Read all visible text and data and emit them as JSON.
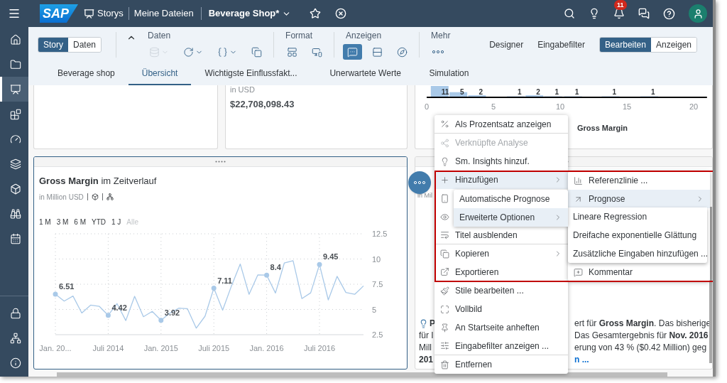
{
  "sidebar": {
    "items": [
      {
        "selected": false
      },
      {
        "selected": false
      },
      {
        "selected": true
      },
      {
        "selected": false
      },
      {
        "selected": false
      },
      {
        "selected": false
      },
      {
        "selected": false
      },
      {
        "selected": false
      },
      {
        "selected": false
      }
    ],
    "bottom_items": [
      {
        "selected": false
      },
      {
        "selected": false
      },
      {
        "selected": false
      }
    ]
  },
  "shell": {
    "logo": "SAP",
    "breadcrumbs": [
      "Storys",
      "Meine Dateien"
    ],
    "title": "Beverage Shop*",
    "notifications": "11"
  },
  "toolbar": {
    "modes": [
      {
        "label": "Story",
        "selected": true
      },
      {
        "label": "Daten",
        "selected": false
      }
    ],
    "groups": [
      {
        "label": "Daten",
        "tools": [
          {
            "selected": false,
            "disabled": true,
            "dropdown": true
          },
          {
            "selected": false,
            "disabled": false,
            "dropdown": true
          },
          {
            "selected": false,
            "disabled": false,
            "dropdown": true
          },
          {
            "selected": false,
            "disabled": false,
            "dropdown": false
          }
        ]
      },
      {
        "label": "Format",
        "tools": [
          {
            "selected": false,
            "disabled": false,
            "dropdown": false
          },
          {
            "selected": false,
            "disabled": false,
            "dropdown": false
          }
        ]
      },
      {
        "label": "Anzeigen",
        "tools": [
          {
            "selected": true,
            "disabled": false,
            "dropdown": false
          },
          {
            "selected": false,
            "disabled": false,
            "dropdown": false
          },
          {
            "selected": false,
            "disabled": false,
            "dropdown": false
          }
        ]
      },
      {
        "label": "Mehr",
        "tools": [
          {
            "selected": false,
            "disabled": false,
            "dropdown": false
          }
        ]
      }
    ],
    "links": [
      "Designer",
      "Eingabefilter"
    ],
    "view_modes": [
      {
        "label": "Bearbeiten",
        "selected": true
      },
      {
        "label": "Anzeigen",
        "selected": false
      }
    ]
  },
  "tabs": [
    {
      "label": "Beverage shop",
      "selected": false
    },
    {
      "label": "Übersicht",
      "selected": true
    },
    {
      "label": "Wichtigste Einflussfakt...",
      "selected": false
    },
    {
      "label": "Unerwartete Werte",
      "selected": false
    },
    {
      "label": "Simulation",
      "selected": false
    }
  ],
  "kpi_card": {
    "unit": "in USD",
    "value": "$22,708,098.43"
  },
  "histogram_card": {
    "chart_data": {
      "type": "bar",
      "xlabel": "Gross Margin",
      "x": [
        1,
        2.4,
        3.8,
        6.7,
        8.1,
        9.5,
        11,
        13.8,
        16.7
      ],
      "values": [
        11,
        5,
        2,
        1,
        2,
        1,
        1,
        1,
        1
      ],
      "xlim": [
        0,
        21
      ],
      "xticks": [
        0,
        5,
        10,
        15,
        20
      ],
      "data_labels": true
    }
  },
  "trend_card": {
    "title": "**Gross Margin** im Zeitverlauf",
    "subtitle": "in Million USD",
    "selected": true,
    "periods": [
      {
        "label": "1 M",
        "disabled": false
      },
      {
        "label": "3 M",
        "disabled": false
      },
      {
        "label": "6 M",
        "disabled": false
      },
      {
        "label": "YTD",
        "disabled": false
      },
      {
        "label": "1 J",
        "disabled": false
      },
      {
        "label": "Alle",
        "disabled": true
      }
    ],
    "chart_data": {
      "type": "line",
      "categories": [
        "Jan. 20...",
        null,
        null,
        null,
        null,
        null,
        "Juli 2014",
        null,
        null,
        null,
        null,
        null,
        "Jan. 2015",
        null,
        null,
        null,
        null,
        null,
        "Juli 2015",
        null,
        null,
        null,
        null,
        null,
        "Jan. 2016",
        null,
        null,
        null,
        null,
        null,
        "Juli 2016",
        null,
        null,
        null,
        null,
        null
      ],
      "series": [
        {
          "color": "#a9c9e8",
          "values": [
            6.51,
            5.83,
            6.33,
            4.65,
            5.43,
            5.3,
            4.42,
            5.58,
            3.9,
            6.3,
            4.28,
            4.8,
            3.92,
            4.63,
            5.13,
            5.08,
            3.15,
            4.33,
            7.11,
            4.93,
            7.33,
            9.5,
            6.5,
            8.43,
            8.4,
            6.63,
            9.6,
            9.83,
            6.08,
            6.65,
            9.45,
            5.95,
            8.28,
            6.68,
            6.5,
            7.33
          ]
        }
      ],
      "ylim": [
        2.5,
        12.5
      ],
      "grid": true,
      "yticks": [
        2.5,
        5,
        7.5,
        10,
        12.5
      ],
      "annotations": [
        {
          "x": "Jan. 20...",
          "y": 6.51,
          "text": "6.51"
        },
        {
          "x": "Juli 2014",
          "y": 4.42,
          "text": "4.42"
        },
        {
          "x": "Jan. 2015",
          "y": 3.92,
          "text": "3.92"
        },
        {
          "x": "Juli 2015",
          "y": 7.11,
          "text": "7.11"
        },
        {
          "x": "Jan. 2016",
          "y": 8.4,
          "text": "8.4"
        },
        {
          "x": "Juli 2016",
          "y": 9.45,
          "text": "9.45"
        }
      ]
    }
  },
  "insight_card": {
    "unit": "in Mil",
    "lines": [
      {
        "left": "**P**",
        "right": "ert für **Gross Margin**. Das bisherige"
      },
      {
        "left": "für I",
        "right": "Das Gesamtergebnis für **Nov. 2016**"
      },
      {
        "left": "Mill",
        "right": "erung von 43 % ($0.42 Million) geg"
      },
      {
        "left": "**201**",
        "right": "**n ...**"
      }
    ]
  },
  "context_menu": {
    "items": [
      {
        "kind": "item",
        "label": "Als Prozentsatz anzeigen",
        "disabled": false,
        "highlighted": false,
        "submenu": false,
        "divider_after": true
      },
      {
        "kind": "item",
        "label": "Verknüpfte Analyse",
        "disabled": true,
        "highlighted": false,
        "submenu": false,
        "divider_after": false
      },
      {
        "kind": "item",
        "label": "Sm. Insights hinzuf.",
        "disabled": false,
        "highlighted": false,
        "submenu": false,
        "divider_after": false
      },
      {
        "kind": "item",
        "label": "Hinzufügen",
        "disabled": false,
        "highlighted": true,
        "submenu": true,
        "divider_after": false
      },
      {
        "kind": "covered"
      },
      {
        "kind": "covered"
      },
      {
        "kind": "item",
        "label": "Titel ausblenden",
        "disabled": false,
        "highlighted": false,
        "submenu": false,
        "divider_after": true
      },
      {
        "kind": "item",
        "label": "Kopieren",
        "disabled": false,
        "highlighted": false,
        "submenu": true,
        "divider_after": false
      },
      {
        "kind": "item",
        "label": "Exportieren",
        "disabled": false,
        "highlighted": false,
        "submenu": false,
        "divider_after": true
      },
      {
        "kind": "item",
        "label": "Stile bearbeiten ...",
        "disabled": false,
        "highlighted": false,
        "submenu": false,
        "divider_after": false
      },
      {
        "kind": "item",
        "label": "Vollbild",
        "disabled": false,
        "highlighted": false,
        "submenu": false,
        "divider_after": false
      },
      {
        "kind": "item",
        "label": "An Startseite anheften",
        "disabled": false,
        "highlighted": false,
        "submenu": false,
        "divider_after": false
      },
      {
        "kind": "item",
        "label": "Eingabefilter anzeigen ...",
        "disabled": false,
        "highlighted": false,
        "submenu": false,
        "divider_after": true
      },
      {
        "kind": "item",
        "label": "Entfernen",
        "disabled": false,
        "highlighted": false,
        "submenu": false,
        "divider_after": false
      }
    ]
  },
  "add_submenu": {
    "items": [
      {
        "label": "Referenzlinie ...",
        "highlighted": false,
        "submenu": false
      },
      {
        "label": "Prognose",
        "highlighted": true,
        "submenu": true
      },
      {
        "label": "Kommentar",
        "highlighted": false,
        "submenu": false
      }
    ]
  },
  "forecast_submenu": {
    "items": [
      {
        "label": "Automatische Prognose",
        "highlighted": false,
        "submenu": false
      },
      {
        "label": "Erweiterte Optionen",
        "highlighted": true,
        "submenu": true
      }
    ]
  },
  "options_submenu": {
    "items": [
      {
        "label": "Lineare Regression"
      },
      {
        "label": "Dreifache exponentielle Glättung"
      },
      {
        "label": "Zusätzliche Eingaben hinzufügen ..."
      }
    ]
  }
}
